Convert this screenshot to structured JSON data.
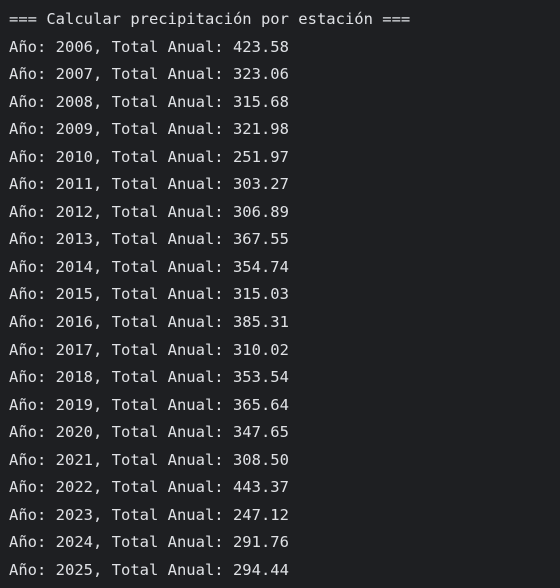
{
  "console": {
    "header": "=== Calcular precipitación por estación ===",
    "lines": [
      "Año: 2006, Total Anual: 423.58",
      "Año: 2007, Total Anual: 323.06",
      "Año: 2008, Total Anual: 315.68",
      "Año: 2009, Total Anual: 321.98",
      "Año: 2010, Total Anual: 251.97",
      "Año: 2011, Total Anual: 303.27",
      "Año: 2012, Total Anual: 306.89",
      "Año: 2013, Total Anual: 367.55",
      "Año: 2014, Total Anual: 354.74",
      "Año: 2015, Total Anual: 315.03",
      "Año: 2016, Total Anual: 385.31",
      "Año: 2017, Total Anual: 310.02",
      "Año: 2018, Total Anual: 353.54",
      "Año: 2019, Total Anual: 365.64",
      "Año: 2020, Total Anual: 347.65",
      "Año: 2021, Total Anual: 308.50",
      "Año: 2022, Total Anual: 443.37",
      "Año: 2023, Total Anual: 247.12",
      "Año: 2024, Total Anual: 291.76",
      "Año: 2025, Total Anual: 294.44"
    ]
  },
  "colors": {
    "background": "#1e1f22",
    "text": "#dfe1e5"
  }
}
